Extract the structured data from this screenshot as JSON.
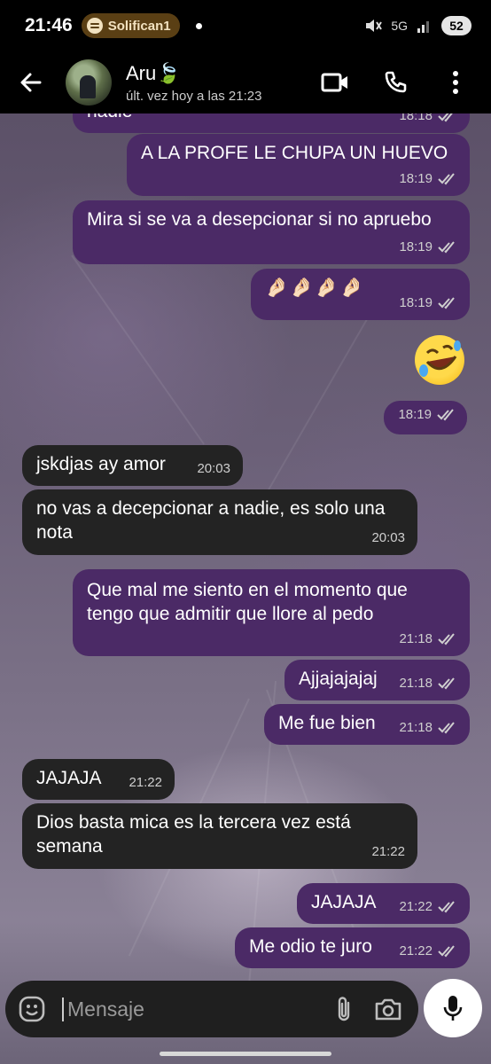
{
  "status_bar": {
    "time": "21:46",
    "spotify_text": "Solifican1",
    "network": "5G",
    "battery": "52"
  },
  "header": {
    "contact_name": "Aru🍃",
    "contact_status": "últ. vez hoy a las 21:23"
  },
  "messages": [
    {
      "text": "nadie",
      "time": "18:18",
      "side": "out"
    },
    {
      "text": "A LA PROFE LE CHUPA UN HUEVO",
      "time": "18:19",
      "side": "out"
    },
    {
      "text": "Mira si se va a desepcionar si no apruebo",
      "time": "18:19",
      "side": "out"
    },
    {
      "text": "🤌🏻🤌🏻🤌🏻🤌🏻",
      "time": "18:19",
      "side": "out"
    },
    {
      "text": "🤣",
      "time": "18:19",
      "side": "out"
    },
    {
      "text": "jskdjas ay amor",
      "time": "20:03",
      "side": "in"
    },
    {
      "text": "no vas a decepcionar a nadie, es solo una nota",
      "time": "20:03",
      "side": "in"
    },
    {
      "text": "Que mal me siento en el momento que tengo que admitir que llore al pedo",
      "time": "21:18",
      "side": "out"
    },
    {
      "text": "Ajjajajajaj",
      "time": "21:18",
      "side": "out"
    },
    {
      "text": "Me fue bien",
      "time": "21:18",
      "side": "out"
    },
    {
      "text": "JAJAJA",
      "time": "21:22",
      "side": "in"
    },
    {
      "text": "Dios basta mica es la tercera vez está semana",
      "time": "21:22",
      "side": "in"
    },
    {
      "text": "JAJAJA",
      "time": "21:22",
      "side": "out"
    },
    {
      "text": "Me odio te juro",
      "time": "21:22",
      "side": "out"
    }
  ],
  "input": {
    "placeholder": "Mensaje"
  },
  "icons": {
    "back": "arrow-left-icon",
    "video": "video-call-icon",
    "phone": "phone-icon",
    "menu": "more-vert-icon",
    "emoji": "emoji-icon",
    "attach": "paperclip-icon",
    "camera": "camera-icon",
    "mic": "mic-icon",
    "read_receipt": "double-check-icon"
  },
  "colors": {
    "outgoing_bubble": "#4b2a66",
    "incoming_bubble": "#232323",
    "header_bg": "#000000"
  }
}
